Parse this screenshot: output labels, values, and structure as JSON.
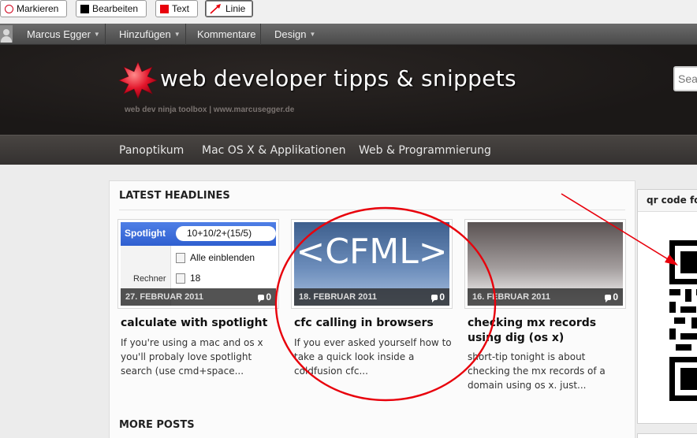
{
  "annotation_toolbar": {
    "buttons": [
      {
        "label": "Markieren",
        "icon": "circle-outline-icon"
      },
      {
        "label": "Bearbeiten",
        "icon": "black-square-icon"
      },
      {
        "label": "Text",
        "icon": "red-square-icon"
      },
      {
        "label": "Linie",
        "icon": "red-arrow-icon"
      }
    ]
  },
  "admin_bar": {
    "user": "Marcus Egger",
    "items": [
      "Hinzufügen",
      "Kommentare",
      "Design"
    ]
  },
  "site": {
    "title": "web developer tipps & snippets",
    "tagline": "web dev ninja toolbox | www.marcusegger.de",
    "search_placeholder": "Search"
  },
  "nav": {
    "items": [
      "Panoptikum",
      "Mac OS X & Applikationen",
      "Web & Programmierung"
    ]
  },
  "content": {
    "latest_title": "LATEST HEADLINES",
    "more_title": "MORE POSTS",
    "cards": [
      {
        "date": "27. FEBRUAR 2011",
        "comments": "0",
        "title": "calculate with spotlight",
        "excerpt": "If you're using a mac and os x you'll probaly love spotlight search (use cmd+space...",
        "thumb": {
          "label": "Spotlight",
          "query": "10+10/2+(15/5)",
          "row1": "Alle einblenden",
          "row2": "18",
          "side_label": "Rechner"
        }
      },
      {
        "date": "18. FEBRUAR 2011",
        "comments": "0",
        "title": "cfc calling in browsers",
        "excerpt": "If you ever asked yourself how to take a quick look inside a coldfusion cfc...",
        "thumb": {
          "text": "<CFML>"
        }
      },
      {
        "date": "16. FEBRUAR 2011",
        "comments": "0",
        "title": "checking mx records using dig (os x)",
        "excerpt": "short-tip tonight is about checking the mx records of a domain using os x. just..."
      }
    ]
  },
  "sidebar": {
    "widget_title": "qr code fo"
  },
  "colors": {
    "annotation_red": "#e8000b",
    "header_bg": "#1e1a19",
    "nav_bg": "#3d3937"
  }
}
